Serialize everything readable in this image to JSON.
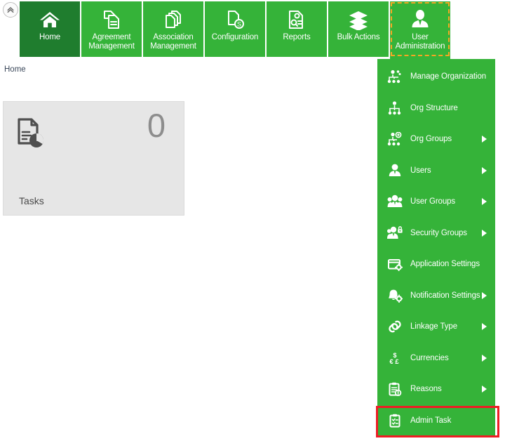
{
  "window": {
    "collapse_button": {
      "icon": "chevron-double-up-icon",
      "title": "Collapse"
    }
  },
  "colors": {
    "brand_green": "#35b339",
    "active_green": "#1f7d2e",
    "focus_dashed": "#f5a623",
    "annotation_red": "#ee1c24",
    "card_gray": "#e6e6e6"
  },
  "navbar": {
    "tiles": [
      {
        "label": "Home",
        "icon": "home-icon",
        "active": true,
        "focused": false
      },
      {
        "label": "Agreement\nManagement",
        "icon": "agreement-documents-icon",
        "active": false,
        "focused": false
      },
      {
        "label": "Association\nManagement",
        "icon": "association-documents-icon",
        "active": false,
        "focused": false
      },
      {
        "label": "Configuration",
        "icon": "document-dollar-icon",
        "active": false,
        "focused": false
      },
      {
        "label": "Reports",
        "icon": "report-search-icon",
        "active": false,
        "focused": false
      },
      {
        "label": "Bulk Actions",
        "icon": "layers-stack-icon",
        "active": false,
        "focused": false
      },
      {
        "label": "User\nAdministration",
        "icon": "user-admin-icon",
        "active": false,
        "focused": true
      }
    ]
  },
  "breadcrumb": {
    "text": "Home"
  },
  "dashboard": {
    "cards": [
      {
        "label": "Tasks",
        "count": "0",
        "icon": "task-report-icon"
      }
    ]
  },
  "dropdown": {
    "owner": "User Administration",
    "items": [
      {
        "label": "Manage Organization",
        "icon": "org-manage-icon",
        "has_submenu": false,
        "highlighted": false
      },
      {
        "label": "Org Structure",
        "icon": "org-structure-icon",
        "has_submenu": false,
        "highlighted": false
      },
      {
        "label": "Org Groups",
        "icon": "org-groups-icon",
        "has_submenu": true,
        "highlighted": false
      },
      {
        "label": "Users",
        "icon": "user-icon",
        "has_submenu": true,
        "highlighted": false
      },
      {
        "label": "User Groups",
        "icon": "user-groups-icon",
        "has_submenu": true,
        "highlighted": false
      },
      {
        "label": "Security Groups",
        "icon": "security-groups-lock-icon",
        "has_submenu": true,
        "highlighted": false
      },
      {
        "label": "Application Settings",
        "icon": "application-settings-icon",
        "has_submenu": false,
        "highlighted": false
      },
      {
        "label": "Notification Settings",
        "icon": "notification-bell-gear-icon",
        "has_submenu": true,
        "highlighted": false
      },
      {
        "label": "Linkage Type",
        "icon": "link-chain-icon",
        "has_submenu": true,
        "highlighted": false
      },
      {
        "label": "Currencies",
        "icon": "currency-dollar-pound-icon",
        "has_submenu": true,
        "highlighted": false
      },
      {
        "label": "Reasons",
        "icon": "clipboard-info-icon",
        "has_submenu": true,
        "highlighted": false
      },
      {
        "label": "Admin Task",
        "icon": "clipboard-task-icon",
        "has_submenu": false,
        "highlighted": true
      }
    ]
  },
  "annotation": {
    "target": "Admin Task",
    "shape": "rectangle",
    "color": "#ee1c24"
  }
}
